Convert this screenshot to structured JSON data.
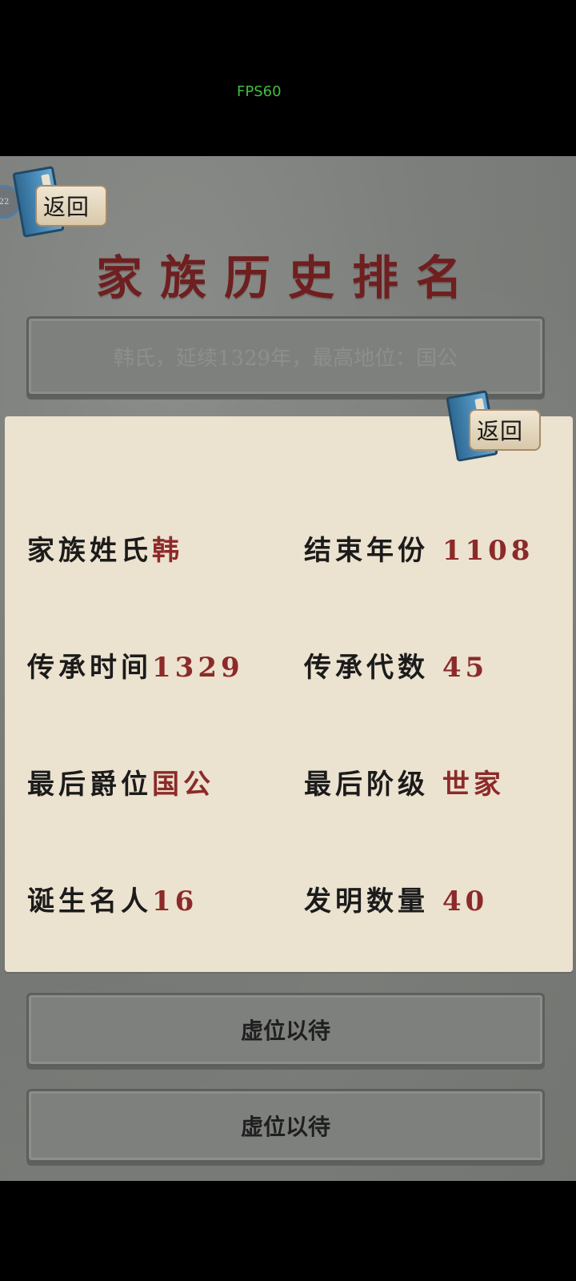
{
  "status_bar": {
    "fps": "FPS60"
  },
  "header": {
    "back_label": "返回",
    "badge": "22",
    "title": "家族历史排名"
  },
  "ranking_list": {
    "first_entry": "韩氏，延续1329年，最高地位：国公",
    "placeholder_entries": [
      "虚位以待",
      "虚位以待"
    ]
  },
  "detail_panel": {
    "back_label": "返回",
    "stats": [
      {
        "label": "家族姓氏",
        "value": "韩"
      },
      {
        "label": "结束年份",
        "value": " 1108"
      },
      {
        "label": "传承时间",
        "value": "1329"
      },
      {
        "label": "传承代数",
        "value": " 45"
      },
      {
        "label": "最后爵位",
        "value": "国公"
      },
      {
        "label": "最后阶级",
        "value": " 世家"
      },
      {
        "label": "诞生名人",
        "value": "16"
      },
      {
        "label": "发明数量",
        "value": " 40"
      }
    ]
  },
  "colors": {
    "title": "#6f1f1f",
    "value_accent": "#8c2a2a",
    "paper": "#ebe2cf",
    "fps": "#3fbf3f"
  },
  "icons": [
    "book-scroll-icon"
  ]
}
